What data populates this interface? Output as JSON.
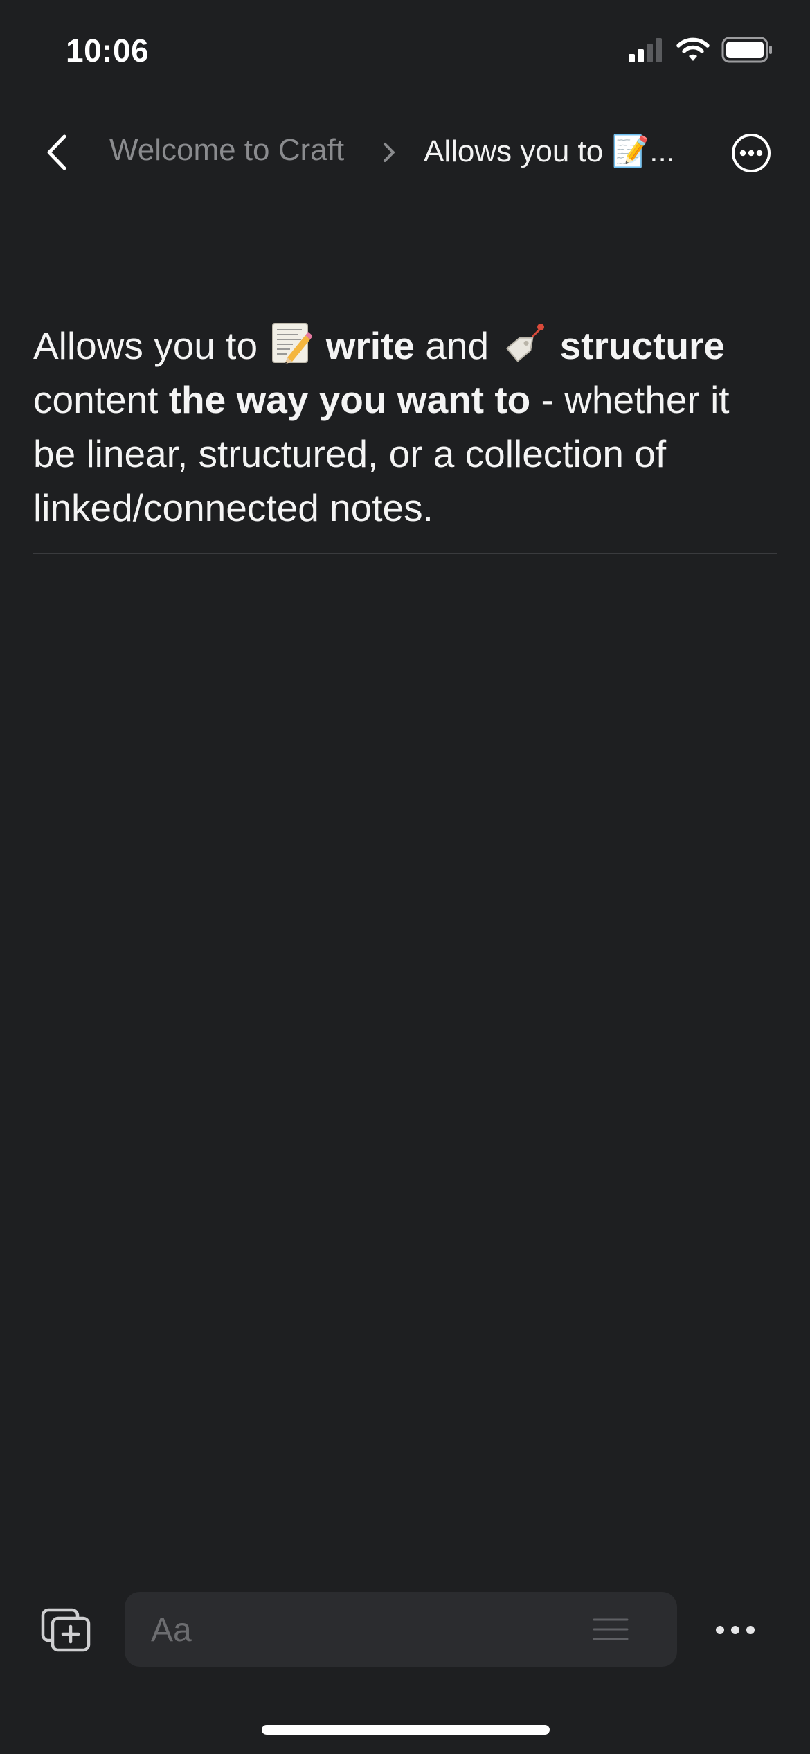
{
  "status_bar": {
    "time": "10:06"
  },
  "nav": {
    "parent": "Welcome to Craft",
    "current": "Allows you to 📝..."
  },
  "content": {
    "t1": "Allows you to ",
    "b1": "write",
    "t2": " and ",
    "b2": "structure",
    "t3": " content ",
    "b3": "the way you want to",
    "t4": " - whether it be linear, structured, or a collection of linked/connected notes."
  },
  "toolbar": {
    "placeholder": "Aa"
  },
  "icons": {
    "back": "chevron-left-icon",
    "more": "ellipsis-circle-icon",
    "new_block": "add-page-icon",
    "style": "lines-icon",
    "overflow": "more-dots-icon",
    "emoji_write": "memo-emoji",
    "emoji_structure": "tag-emoji"
  },
  "colors": {
    "background": "#1e1f21",
    "text": "#f4f4f4",
    "muted": "#8a8b8e",
    "input_bg": "#2b2c2f"
  }
}
